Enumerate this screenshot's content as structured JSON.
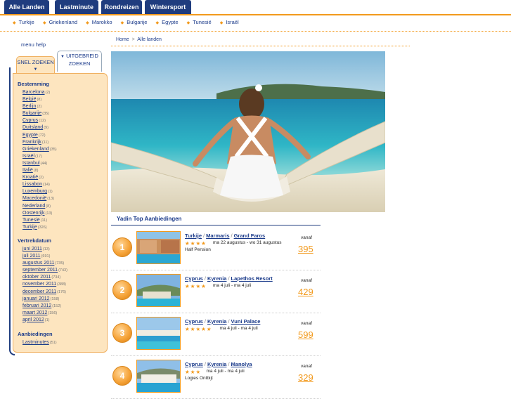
{
  "top_nav": [
    "Alle Landen",
    "Lastminute",
    "Rondreizen",
    "Wintersport"
  ],
  "countries": [
    "Turkije",
    "Griekenland",
    "Marokko",
    "Bulgarije",
    "Egypte",
    "Tunesië",
    "Israël"
  ],
  "menu_help": "menu help",
  "search_tabs": {
    "snel": "SNEL ZOEKEN",
    "uitgebreid": "UITGEBREID ZOEKEN"
  },
  "sidebar": {
    "bestemming_title": "Bestemming",
    "bestemmingen": [
      {
        "label": "Barcelona",
        "count": "(2)"
      },
      {
        "label": "België",
        "count": "(8)"
      },
      {
        "label": "Berlijn",
        "count": "(2)"
      },
      {
        "label": "Bulgarije",
        "count": "(35)"
      },
      {
        "label": "Cyprus",
        "count": "(12)"
      },
      {
        "label": "Duitsland",
        "count": "(9)"
      },
      {
        "label": "Egypte",
        "count": "(72)"
      },
      {
        "label": "Frankrijk",
        "count": "(11)"
      },
      {
        "label": "Griekenland",
        "count": "(35)"
      },
      {
        "label": "Israël",
        "count": "(17)"
      },
      {
        "label": "Istanbul",
        "count": "(44)"
      },
      {
        "label": "Italië",
        "count": "(8)"
      },
      {
        "label": "Kroatië",
        "count": "(2)"
      },
      {
        "label": "Lissabon",
        "count": "(14)"
      },
      {
        "label": "Luxemburg",
        "count": "(1)"
      },
      {
        "label": "Macedonië",
        "count": "(13)"
      },
      {
        "label": "Nederland",
        "count": "(8)"
      },
      {
        "label": "Oostenrijk",
        "count": "(13)"
      },
      {
        "label": "Tunesië",
        "count": "(11)"
      },
      {
        "label": "Turkije",
        "count": "(326)"
      }
    ],
    "vertrekdatum_title": "Vertrekdatum",
    "vertrekdata": [
      {
        "label": "juni 2011",
        "count": "(13)"
      },
      {
        "label": "juli 2011",
        "count": "(691)"
      },
      {
        "label": "augustus 2011",
        "count": "(735)"
      },
      {
        "label": "september 2011",
        "count": "(743)"
      },
      {
        "label": "oktober 2011",
        "count": "(734)"
      },
      {
        "label": "november 2011",
        "count": "(388)"
      },
      {
        "label": "december 2011",
        "count": "(176)"
      },
      {
        "label": "januari 2012",
        "count": "(158)"
      },
      {
        "label": "februari 2012",
        "count": "(152)"
      },
      {
        "label": "maart 2012",
        "count": "(156)"
      },
      {
        "label": "april 2012",
        "count": "(1)"
      }
    ],
    "aanbiedingen_title": "Aanbiedingen",
    "aanbiedingen": [
      {
        "label": "Lastminutes",
        "count": "(51)"
      }
    ]
  },
  "breadcrumb": {
    "home": "Home",
    "sep": ">",
    "current": "Alle landen"
  },
  "offers_title": "Yadin Top Aanbiedingen",
  "offers": [
    {
      "num": "1",
      "country": "Turkije",
      "region": "Marmaris",
      "hotel": "Grand Faros",
      "stars": "★★★★",
      "dates": "ma 22 augustus - wo 31 augustus",
      "board": "Half Pension",
      "vanaf": "vanaf",
      "price": "395"
    },
    {
      "num": "2",
      "country": "Cyprus",
      "region": "Kyrenia",
      "hotel": "Lapethos Resort",
      "stars": "★★★★",
      "dates": "ma 4 juli - ma 4 juli",
      "board": "",
      "vanaf": "vanaf",
      "price": "429"
    },
    {
      "num": "3",
      "country": "Cyprus",
      "region": "Kyrenia",
      "hotel": "Vuni Palace",
      "stars": "★★★★★",
      "dates": "ma 4 juli - ma 4 juli",
      "board": "",
      "vanaf": "vanaf",
      "price": "599"
    },
    {
      "num": "4",
      "country": "Cyprus",
      "region": "Kyrenia",
      "hotel": "Manolya",
      "stars": "★★★",
      "dates": "ma 4 juli - ma 4 juli",
      "board": "Logies Ontbijt",
      "vanaf": "vanaf",
      "price": "329"
    }
  ],
  "colors": {
    "navy": "#1f3c7e",
    "orange": "#f29a1d",
    "panel": "#fde5bf"
  }
}
